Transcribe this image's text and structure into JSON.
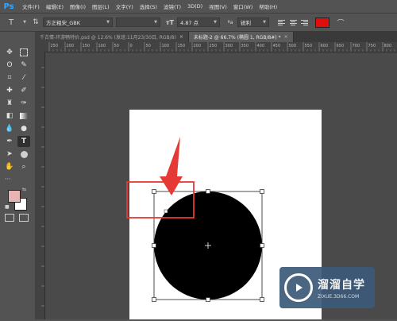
{
  "app": {
    "logo": "Ps"
  },
  "menu": [
    "文件(F)",
    "编辑(E)",
    "图像(I)",
    "图层(L)",
    "文字(Y)",
    "选择(S)",
    "滤镜(T)",
    "3D(D)",
    "视图(V)",
    "窗口(W)",
    "帮助(H)"
  ],
  "options": {
    "font_family": "方正粗宋_GBK",
    "font_style": "",
    "font_size": "4.87 点",
    "aa_label": "ªa",
    "aa_mode": "锐利",
    "text_color": "#e10e0e"
  },
  "tabs": [
    {
      "label": "千古情-环游畅特价.psd @ 12.6% (发班:11月23/30日, RGB/8)",
      "active": false
    },
    {
      "label": "未标题-2 @ 66.7% (椭圆 1, RGB/8#) *",
      "active": true
    }
  ],
  "ruler_ticks": [
    "250",
    "200",
    "150",
    "100",
    "50",
    "0",
    "50",
    "100",
    "150",
    "200",
    "250",
    "300",
    "350",
    "400",
    "450",
    "500",
    "550",
    "600",
    "650",
    "700",
    "750",
    "800",
    "850"
  ],
  "watermark": {
    "title": "溜溜自学",
    "url": "ZIXUE.3D66.COM"
  },
  "colors": {
    "foreground": "#e8b4b4",
    "background": "#ffffff",
    "highlight": "#e53935"
  },
  "icons": [
    "move-icon",
    "marquee-icon",
    "lasso-icon",
    "quick-select-icon",
    "crop-icon",
    "eyedropper-icon",
    "healing-icon",
    "brush-icon",
    "stamp-icon",
    "history-brush-icon",
    "eraser-icon",
    "gradient-icon",
    "blur-icon",
    "dodge-icon",
    "pen-icon",
    "type-icon",
    "path-select-icon",
    "shape-icon",
    "hand-icon",
    "zoom-icon"
  ]
}
